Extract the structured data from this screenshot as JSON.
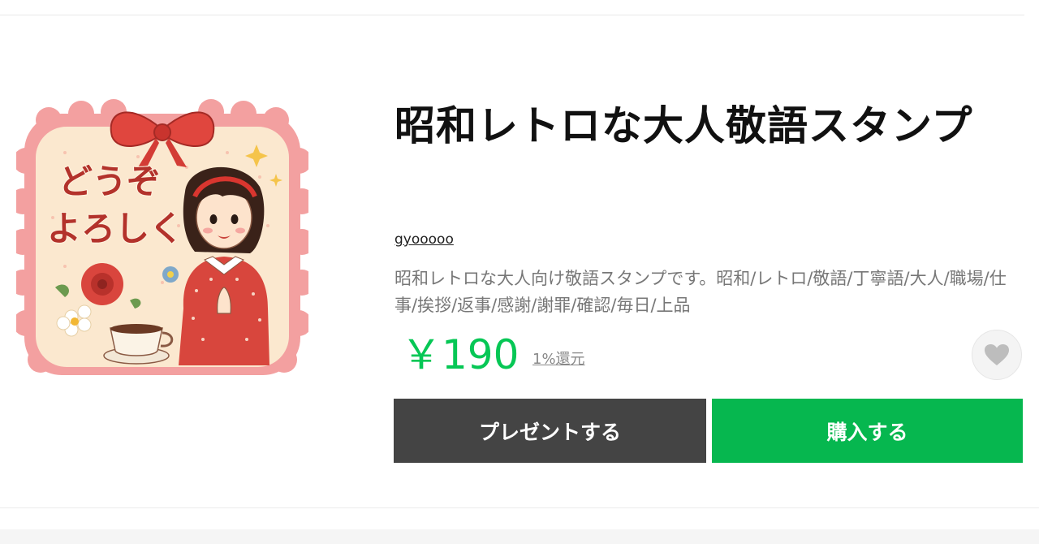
{
  "product": {
    "title": "昭和レトロな大人敬語スタンプ",
    "author": "gyooooo",
    "description": "昭和レトロな大人向け敬語スタンプです。昭和/レトロ/敬語/丁寧語/大人/職場/仕事/挨拶/返事/感謝/謝罪/確認/毎日/上品",
    "price": "￥190",
    "return_label": "1%還元"
  },
  "sticker": {
    "line1": "どうぞ",
    "line2": "よろしく"
  },
  "actions": {
    "present_label": "プレゼントする",
    "buy_label": "購入する"
  },
  "icons": {
    "favorite": "heart-icon"
  },
  "colors": {
    "price": "#06c755",
    "buy_button": "#06b74f",
    "present_button": "#444444"
  }
}
